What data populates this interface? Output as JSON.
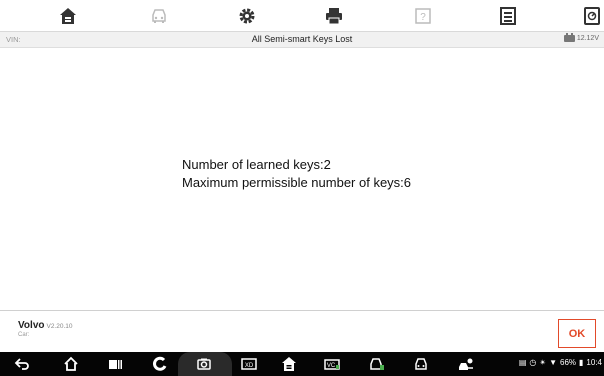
{
  "infobar": {
    "vin": "VIN:",
    "title": "All Semi-smart Keys Lost",
    "voltage": "12.12V"
  },
  "message": {
    "line1": "Number of learned keys:2",
    "line2": "Maximum permissible number of keys:6"
  },
  "footer": {
    "make": "Volvo",
    "version": "V2.20.10",
    "car": "Car:",
    "ok_label": "OK"
  },
  "statusbar": {
    "battery": "66%",
    "time": "10:4"
  },
  "colors": {
    "accent": "#e24a2a",
    "navbar": "#050505"
  }
}
